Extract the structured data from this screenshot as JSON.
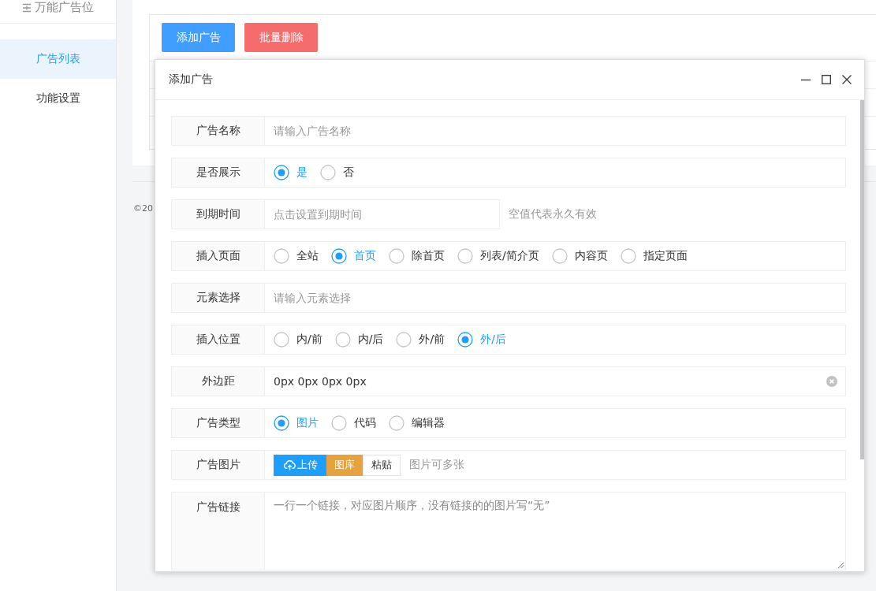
{
  "sidebar": {
    "title": "万能广告位",
    "items": [
      {
        "label": "广告列表",
        "selected": true
      },
      {
        "label": "功能设置",
        "selected": false
      }
    ]
  },
  "toolbar": {
    "buttons": [
      {
        "label": "添加广告",
        "kind": "primary"
      },
      {
        "label": "批量删除",
        "kind": "danger"
      }
    ]
  },
  "footer": {
    "text": "©20"
  },
  "dialog": {
    "title": "添加广告",
    "fields": [
      {
        "kind": "text",
        "label": "广告名称",
        "placeholder": "请输入广告名称"
      },
      {
        "kind": "radio",
        "label": "是否展示",
        "options": [
          {
            "label": "是",
            "selected": true
          },
          {
            "label": "否",
            "selected": false
          }
        ]
      },
      {
        "kind": "date",
        "label": "到期时间",
        "placeholder": "点击设置到期时间",
        "hint": "空值代表永久有效"
      },
      {
        "kind": "radio",
        "label": "插入页面",
        "options": [
          {
            "label": "全站",
            "selected": false
          },
          {
            "label": "首页",
            "selected": true
          },
          {
            "label": "除首页",
            "selected": false
          },
          {
            "label": "列表/简介页",
            "selected": false
          },
          {
            "label": "内容页",
            "selected": false
          },
          {
            "label": "指定页面",
            "selected": false
          }
        ]
      },
      {
        "kind": "text",
        "label": "元素选择",
        "placeholder": "请输入元素选择"
      },
      {
        "kind": "radio",
        "label": "插入位置",
        "options": [
          {
            "label": "内/前",
            "selected": false
          },
          {
            "label": "内/后",
            "selected": false
          },
          {
            "label": "外/前",
            "selected": false
          },
          {
            "label": "外/后",
            "selected": true
          }
        ]
      },
      {
        "kind": "text",
        "label": "外边距",
        "value": "0px 0px 0px 0px",
        "clearable": true
      },
      {
        "kind": "radio",
        "label": "广告类型",
        "options": [
          {
            "label": "图片",
            "selected": true
          },
          {
            "label": "代码",
            "selected": false
          },
          {
            "label": "编辑器",
            "selected": false
          }
        ]
      },
      {
        "kind": "upload",
        "label": "广告图片",
        "buttons": [
          {
            "label": "上传",
            "kind": "primary"
          },
          {
            "label": "图库",
            "kind": "warning"
          },
          {
            "label": "粘贴",
            "kind": "plain"
          }
        ],
        "hint": "图片可多张"
      },
      {
        "kind": "textarea",
        "label": "广告链接",
        "placeholder": "一行一个链接，对应图片顺序，没有链接的的图片写“无”"
      }
    ]
  }
}
